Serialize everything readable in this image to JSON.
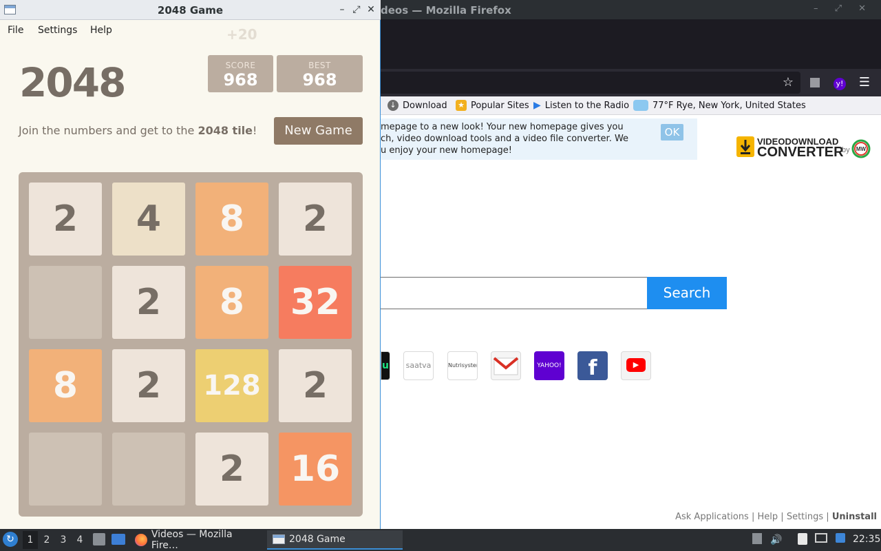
{
  "firefox": {
    "title": "Videos — Mozilla Firefox",
    "title_visible": "deos — Mozilla Firefox",
    "bookmarks": [
      {
        "label": "Download",
        "icon": "download-icon"
      },
      {
        "label": "Popular Sites",
        "icon": "star-icon"
      },
      {
        "label": "Listen to the Radio",
        "icon": "play-icon"
      },
      {
        "label": "77°F Rye, New York, United States",
        "icon": "weather-icon"
      }
    ],
    "notice_lines": [
      "mepage to a new look! Your new homepage gives you",
      "ch, video download tools and a video file converter. We",
      "u enjoy your new homepage!"
    ],
    "notice_ok": "OK",
    "logo_text_top": "VIDEODOWNLOAD",
    "logo_text_bottom": "CONVERTER",
    "logo_by": "by",
    "logo_badge": "MW",
    "search_button": "Search",
    "search_value": "",
    "site_tiles": [
      "u",
      "saatva",
      "Nutrisystem",
      "Gmail",
      "YAHOO!",
      "f",
      "▶"
    ],
    "footer": {
      "ask": "Ask Applications",
      "help": "Help",
      "settings": "Settings",
      "uninstall": "Uninstall",
      "sep": "|"
    }
  },
  "game_window": {
    "title": "2048 Game",
    "menu": [
      "File",
      "Settings",
      "Help"
    ],
    "score_delta": "+20",
    "heading": "2048",
    "score_label": "SCORE",
    "score": "968",
    "best_label": "BEST",
    "best": "968",
    "intro_prefix": "Join the numbers and get to the ",
    "intro_bold": "2048 tile",
    "intro_suffix": "!",
    "new_game": "New Game",
    "board": [
      [
        "2",
        "4",
        "8",
        "2"
      ],
      [
        "",
        "2",
        "8",
        "32"
      ],
      [
        "8",
        "2",
        "128",
        "2"
      ],
      [
        "",
        "",
        "2",
        "16"
      ]
    ]
  },
  "tile_colors": {
    "": {
      "bg": "#cdc1b4",
      "fg": "#776e65"
    },
    "2": {
      "bg": "#eee4da",
      "fg": "#776e65"
    },
    "4": {
      "bg": "#ede0c8",
      "fg": "#776e65"
    },
    "8": {
      "bg": "#f2b179",
      "fg": "#f9f6f2"
    },
    "16": {
      "bg": "#f59563",
      "fg": "#f9f6f2"
    },
    "32": {
      "bg": "#f67c5f",
      "fg": "#f9f6f2"
    },
    "128": {
      "bg": "#edcf72",
      "fg": "#f9f6f2"
    }
  },
  "taskbar": {
    "workspaces": [
      "1",
      "2",
      "3",
      "4"
    ],
    "tasks": [
      {
        "label": "Videos — Mozilla Fire…",
        "icon": "firefox-icon"
      },
      {
        "label": "2048 Game",
        "icon": "window-icon"
      }
    ],
    "clock": "22:35"
  }
}
